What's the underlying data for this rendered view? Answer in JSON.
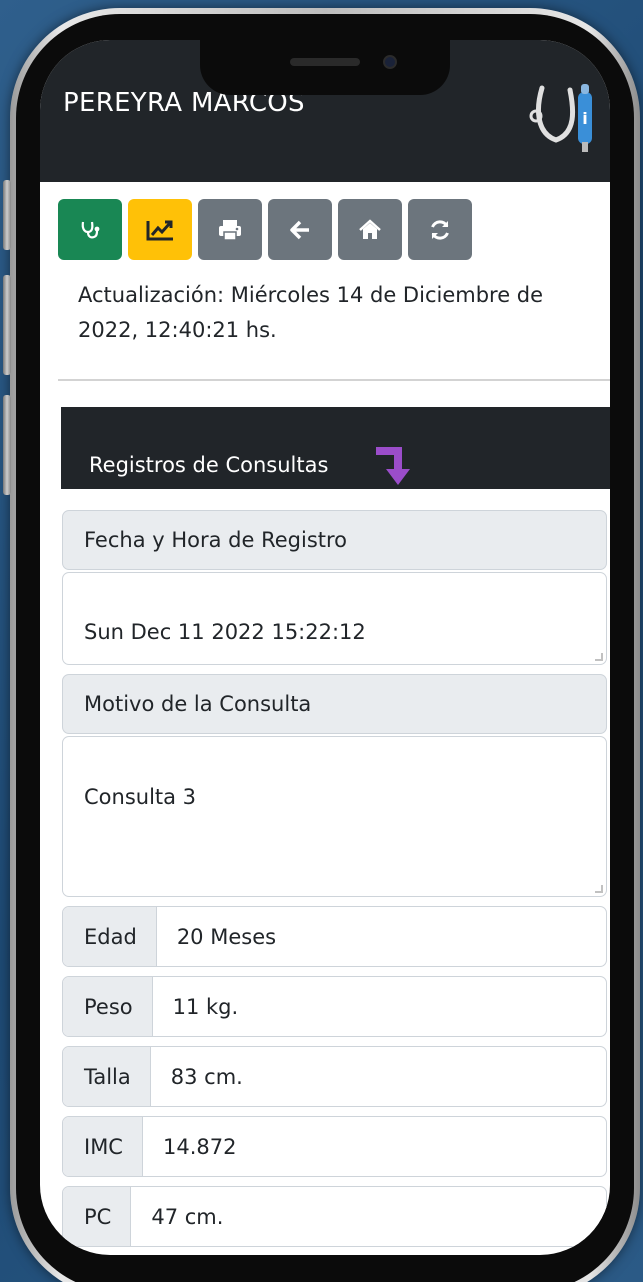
{
  "header": {
    "title": "PEREYRA MARCOS",
    "logo_icon": "stethoscope-logo-icon"
  },
  "toolbar": [
    {
      "name": "stethoscope-button",
      "icon": "stethoscope-icon",
      "color": "#198754"
    },
    {
      "name": "chart-button",
      "icon": "chart-line-icon",
      "color": "#ffc107"
    },
    {
      "name": "print-button",
      "icon": "print-icon",
      "color": "#6c757d"
    },
    {
      "name": "back-button",
      "icon": "arrow-left-icon",
      "color": "#6c757d"
    },
    {
      "name": "home-button",
      "icon": "home-icon",
      "color": "#6c757d"
    },
    {
      "name": "refresh-button",
      "icon": "refresh-icon",
      "color": "#6c757d"
    }
  ],
  "update": {
    "text": "Actualización: Miércoles 14 de Diciembre de 2022, 12:40:21 hs."
  },
  "section": {
    "title": "Registros de Consultas",
    "arrow_color": "#9b4dca"
  },
  "record": {
    "date_label": "Fecha y Hora de Registro",
    "date_value": "Sun Dec 11 2022 15:22:12",
    "reason_label": "Motivo de la Consulta",
    "reason_value": "Consulta 3",
    "fields": [
      {
        "label": "Edad",
        "value": "20 Meses"
      },
      {
        "label": "Peso",
        "value": "11 kg."
      },
      {
        "label": "Talla",
        "value": "83 cm."
      },
      {
        "label": "IMC",
        "value": "14.872"
      },
      {
        "label": "PC",
        "value": "47 cm."
      }
    ]
  }
}
